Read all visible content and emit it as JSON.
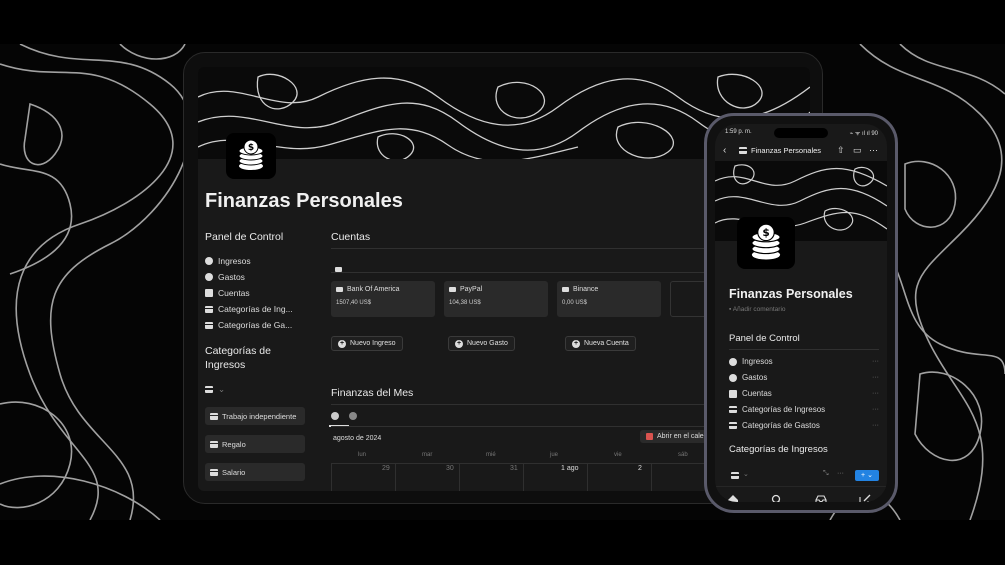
{
  "colors": {
    "background": "#000000",
    "surface": "#191919",
    "card": "#2a2a2a",
    "accent_blue": "#2383e2",
    "calendar_red": "#d9534f"
  },
  "tablet": {
    "page_title": "Finanzas Personales",
    "sidebar": {
      "panel_heading": "Panel de Control",
      "items": [
        {
          "label": "Ingresos",
          "icon": "arrow-up-circle-icon"
        },
        {
          "label": "Gastos",
          "icon": "arrow-down-circle-icon"
        },
        {
          "label": "Cuentas",
          "icon": "card-icon"
        },
        {
          "label": "Categorías de Ing...",
          "icon": "coin-stack-icon"
        },
        {
          "label": "Categorías de Ga...",
          "icon": "coin-stack-icon"
        }
      ],
      "categories_heading": "Categorías de Ingresos",
      "categories": [
        {
          "label": "Trabajo independiente"
        },
        {
          "label": "Regalo"
        },
        {
          "label": "Salario"
        }
      ]
    },
    "accounts": {
      "heading": "Cuentas",
      "cards": [
        {
          "name": "Bank Of America",
          "amount": "1507,40 US$"
        },
        {
          "name": "PayPal",
          "amount": "104,38 US$"
        },
        {
          "name": "Binance",
          "amount": "0,00 US$"
        }
      ]
    },
    "buttons": {
      "new_income": "Nuevo Ingreso",
      "new_expense": "Nuevo Gasto",
      "new_account": "Nueva Cuenta"
    },
    "month": {
      "heading": "Finanzas del Mes",
      "month_label": "agosto de 2024",
      "open_calendar": "Abrir en el cale",
      "weekdays": [
        "lun",
        "mar",
        "mié",
        "jue",
        "vie",
        "sáb"
      ],
      "days": [
        "29",
        "30",
        "31",
        "1 ago",
        "2"
      ]
    }
  },
  "phone": {
    "status_time": "1:59 p. m.",
    "status_icons": "⌁ ᯤ ıl ıl 90",
    "nav_title": "Finanzas Personales",
    "page_title": "Finanzas Personales",
    "add_comment": "Añadir comentario",
    "panel_heading": "Panel de Control",
    "items": [
      {
        "label": "Ingresos"
      },
      {
        "label": "Gastos"
      },
      {
        "label": "Cuentas"
      },
      {
        "label": "Categorías de Ingresos"
      },
      {
        "label": "Categorías de Gastos"
      }
    ],
    "categories_heading": "Categorías de Ingresos",
    "row_more": "···",
    "add_button": "+ ⌄"
  }
}
